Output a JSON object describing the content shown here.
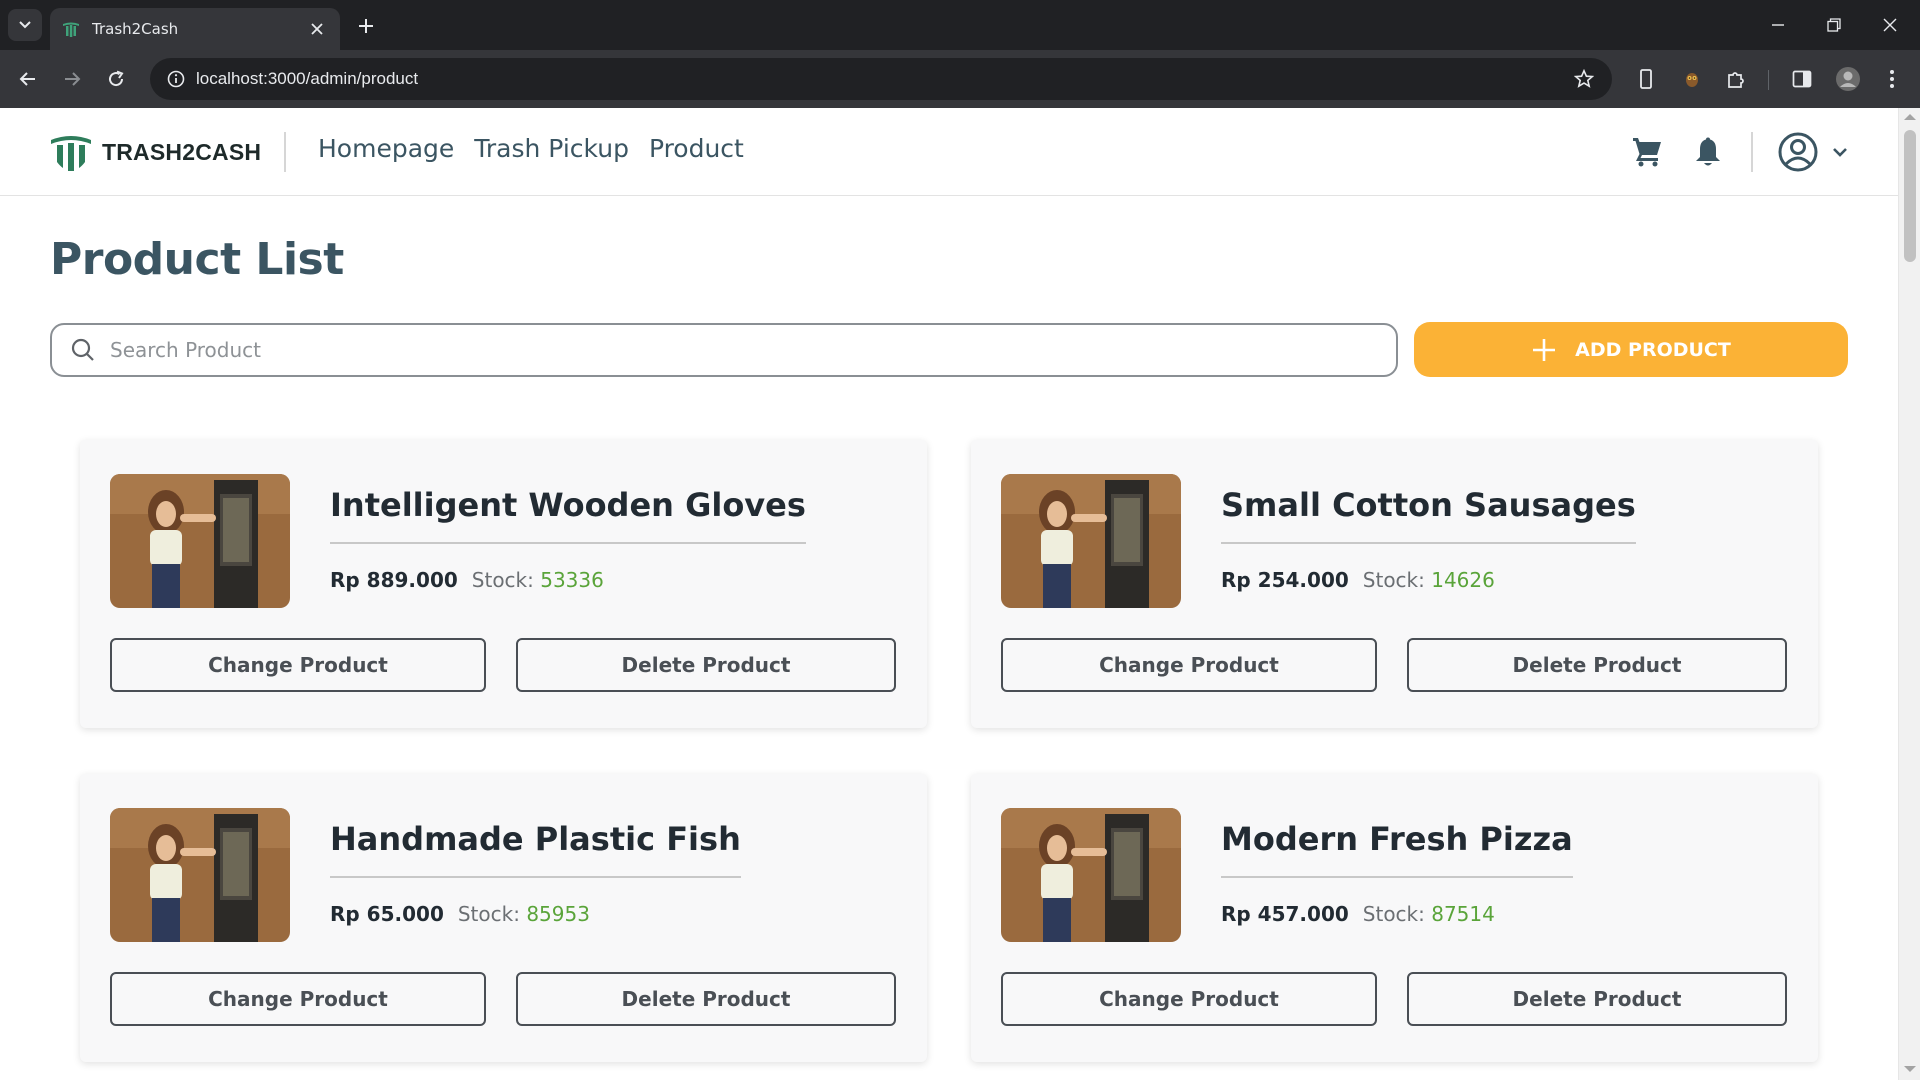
{
  "browser": {
    "tab_title": "Trash2Cash",
    "url": "localhost:3000/admin/product"
  },
  "header": {
    "logo_text": "TRASH2CASH",
    "nav": [
      "Homepage",
      "Trash Pickup",
      "Product"
    ]
  },
  "page": {
    "title": "Product List",
    "search_placeholder": "Search Product",
    "add_button_label": "ADD PRODUCT"
  },
  "products": [
    {
      "name": "Intelligent Wooden Gloves",
      "price": "Rp 889.000",
      "stock_label": "Stock:",
      "stock": "53336",
      "change_label": "Change Product",
      "delete_label": "Delete Product"
    },
    {
      "name": "Small Cotton Sausages",
      "price": "Rp 254.000",
      "stock_label": "Stock:",
      "stock": "14626",
      "change_label": "Change Product",
      "delete_label": "Delete Product"
    },
    {
      "name": "Handmade Plastic Fish",
      "price": "Rp 65.000",
      "stock_label": "Stock:",
      "stock": "85953",
      "change_label": "Change Product",
      "delete_label": "Delete Product"
    },
    {
      "name": "Modern Fresh Pizza",
      "price": "Rp 457.000",
      "stock_label": "Stock:",
      "stock": "87514",
      "change_label": "Change Product",
      "delete_label": "Delete Product"
    }
  ],
  "colors": {
    "accent": "#fbb236",
    "brand_green": "#2e7d5b",
    "nav_text": "#3b5562",
    "stock_green": "#5aa43a"
  }
}
